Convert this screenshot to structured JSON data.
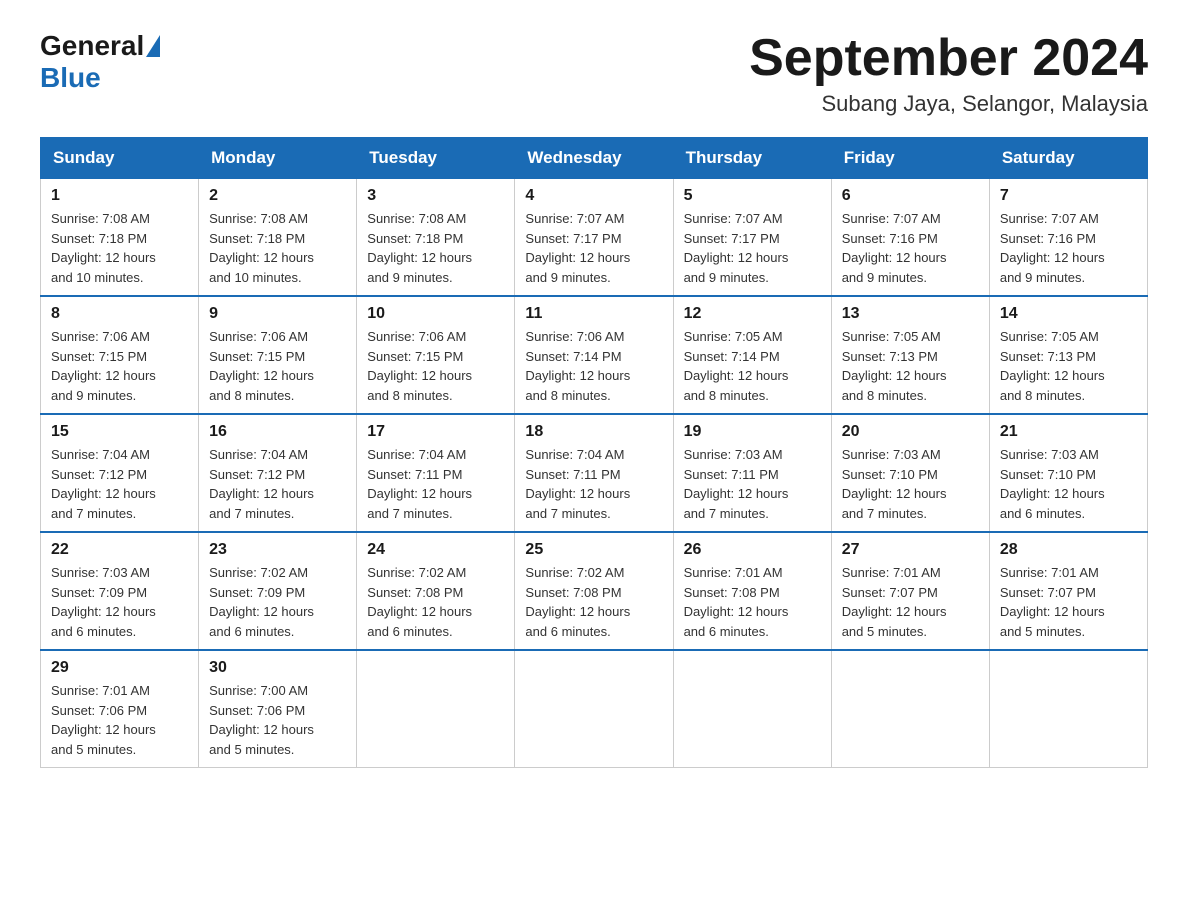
{
  "header": {
    "logo_general": "General",
    "logo_blue": "Blue",
    "month_title": "September 2024",
    "location": "Subang Jaya, Selangor, Malaysia"
  },
  "weekdays": [
    "Sunday",
    "Monday",
    "Tuesday",
    "Wednesday",
    "Thursday",
    "Friday",
    "Saturday"
  ],
  "weeks": [
    [
      {
        "day": "1",
        "sunrise": "7:08 AM",
        "sunset": "7:18 PM",
        "daylight": "12 hours and 10 minutes."
      },
      {
        "day": "2",
        "sunrise": "7:08 AM",
        "sunset": "7:18 PM",
        "daylight": "12 hours and 10 minutes."
      },
      {
        "day": "3",
        "sunrise": "7:08 AM",
        "sunset": "7:18 PM",
        "daylight": "12 hours and 9 minutes."
      },
      {
        "day": "4",
        "sunrise": "7:07 AM",
        "sunset": "7:17 PM",
        "daylight": "12 hours and 9 minutes."
      },
      {
        "day": "5",
        "sunrise": "7:07 AM",
        "sunset": "7:17 PM",
        "daylight": "12 hours and 9 minutes."
      },
      {
        "day": "6",
        "sunrise": "7:07 AM",
        "sunset": "7:16 PM",
        "daylight": "12 hours and 9 minutes."
      },
      {
        "day": "7",
        "sunrise": "7:07 AM",
        "sunset": "7:16 PM",
        "daylight": "12 hours and 9 minutes."
      }
    ],
    [
      {
        "day": "8",
        "sunrise": "7:06 AM",
        "sunset": "7:15 PM",
        "daylight": "12 hours and 9 minutes."
      },
      {
        "day": "9",
        "sunrise": "7:06 AM",
        "sunset": "7:15 PM",
        "daylight": "12 hours and 8 minutes."
      },
      {
        "day": "10",
        "sunrise": "7:06 AM",
        "sunset": "7:15 PM",
        "daylight": "12 hours and 8 minutes."
      },
      {
        "day": "11",
        "sunrise": "7:06 AM",
        "sunset": "7:14 PM",
        "daylight": "12 hours and 8 minutes."
      },
      {
        "day": "12",
        "sunrise": "7:05 AM",
        "sunset": "7:14 PM",
        "daylight": "12 hours and 8 minutes."
      },
      {
        "day": "13",
        "sunrise": "7:05 AM",
        "sunset": "7:13 PM",
        "daylight": "12 hours and 8 minutes."
      },
      {
        "day": "14",
        "sunrise": "7:05 AM",
        "sunset": "7:13 PM",
        "daylight": "12 hours and 8 minutes."
      }
    ],
    [
      {
        "day": "15",
        "sunrise": "7:04 AM",
        "sunset": "7:12 PM",
        "daylight": "12 hours and 7 minutes."
      },
      {
        "day": "16",
        "sunrise": "7:04 AM",
        "sunset": "7:12 PM",
        "daylight": "12 hours and 7 minutes."
      },
      {
        "day": "17",
        "sunrise": "7:04 AM",
        "sunset": "7:11 PM",
        "daylight": "12 hours and 7 minutes."
      },
      {
        "day": "18",
        "sunrise": "7:04 AM",
        "sunset": "7:11 PM",
        "daylight": "12 hours and 7 minutes."
      },
      {
        "day": "19",
        "sunrise": "7:03 AM",
        "sunset": "7:11 PM",
        "daylight": "12 hours and 7 minutes."
      },
      {
        "day": "20",
        "sunrise": "7:03 AM",
        "sunset": "7:10 PM",
        "daylight": "12 hours and 7 minutes."
      },
      {
        "day": "21",
        "sunrise": "7:03 AM",
        "sunset": "7:10 PM",
        "daylight": "12 hours and 6 minutes."
      }
    ],
    [
      {
        "day": "22",
        "sunrise": "7:03 AM",
        "sunset": "7:09 PM",
        "daylight": "12 hours and 6 minutes."
      },
      {
        "day": "23",
        "sunrise": "7:02 AM",
        "sunset": "7:09 PM",
        "daylight": "12 hours and 6 minutes."
      },
      {
        "day": "24",
        "sunrise": "7:02 AM",
        "sunset": "7:08 PM",
        "daylight": "12 hours and 6 minutes."
      },
      {
        "day": "25",
        "sunrise": "7:02 AM",
        "sunset": "7:08 PM",
        "daylight": "12 hours and 6 minutes."
      },
      {
        "day": "26",
        "sunrise": "7:01 AM",
        "sunset": "7:08 PM",
        "daylight": "12 hours and 6 minutes."
      },
      {
        "day": "27",
        "sunrise": "7:01 AM",
        "sunset": "7:07 PM",
        "daylight": "12 hours and 5 minutes."
      },
      {
        "day": "28",
        "sunrise": "7:01 AM",
        "sunset": "7:07 PM",
        "daylight": "12 hours and 5 minutes."
      }
    ],
    [
      {
        "day": "29",
        "sunrise": "7:01 AM",
        "sunset": "7:06 PM",
        "daylight": "12 hours and 5 minutes."
      },
      {
        "day": "30",
        "sunrise": "7:00 AM",
        "sunset": "7:06 PM",
        "daylight": "12 hours and 5 minutes."
      },
      null,
      null,
      null,
      null,
      null
    ]
  ],
  "labels": {
    "sunrise": "Sunrise:",
    "sunset": "Sunset:",
    "daylight": "Daylight:"
  }
}
